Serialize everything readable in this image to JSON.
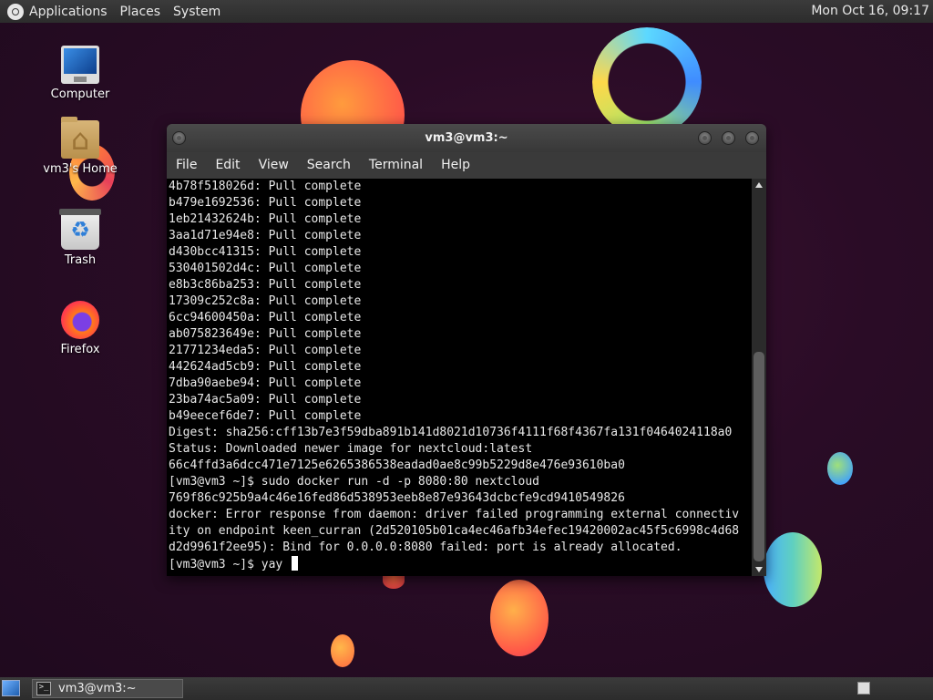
{
  "top_panel": {
    "menus": [
      "Applications",
      "Places",
      "System"
    ],
    "clock": "Mon Oct 16, 09:17"
  },
  "desktop_icons": [
    {
      "label": "Computer",
      "icon": "computer-icon"
    },
    {
      "label": "vm3's Home",
      "icon": "home-folder-icon"
    },
    {
      "label": "Trash",
      "icon": "trash-icon"
    },
    {
      "label": "Firefox",
      "icon": "firefox-icon"
    }
  ],
  "terminal": {
    "title": "vm3@vm3:~",
    "menu": [
      "File",
      "Edit",
      "View",
      "Search",
      "Terminal",
      "Help"
    ],
    "lines": [
      "4b78f518026d: Pull complete",
      "b479e1692536: Pull complete",
      "1eb21432624b: Pull complete",
      "3aa1d71e94e8: Pull complete",
      "d430bcc41315: Pull complete",
      "530401502d4c: Pull complete",
      "e8b3c86ba253: Pull complete",
      "17309c252c8a: Pull complete",
      "6cc94600450a: Pull complete",
      "ab075823649e: Pull complete",
      "21771234eda5: Pull complete",
      "442624ad5cb9: Pull complete",
      "7dba90aebe94: Pull complete",
      "23ba74ac5a09: Pull complete",
      "b49eecef6de7: Pull complete",
      "Digest: sha256:cff13b7e3f59dba891b141d8021d10736f4111f68f4367fa131f0464024118a0",
      "Status: Downloaded newer image for nextcloud:latest",
      "66c4ffd3a6dcc471e7125e6265386538eadad0ae8c99b5229d8e476e93610ba0",
      "[vm3@vm3 ~]$ sudo docker run -d -p 8080:80 nextcloud",
      "769f86c925b9a4c46e16fed86d538953eeb8e87e93643dcbcfe9cd9410549826",
      "docker: Error response from daemon: driver failed programming external connectiv",
      "ity on endpoint keen_curran (2d520105b01ca4ec46afb34efec19420002ac45f5c6998c4d68",
      "d2d9961f2ee95): Bind for 0.0.0.0:8080 failed: port is already allocated."
    ],
    "prompt": "[vm3@vm3 ~]$ yay "
  },
  "taskbar": {
    "task_label": "vm3@vm3:~",
    "task_icon_glyph": ">_"
  }
}
